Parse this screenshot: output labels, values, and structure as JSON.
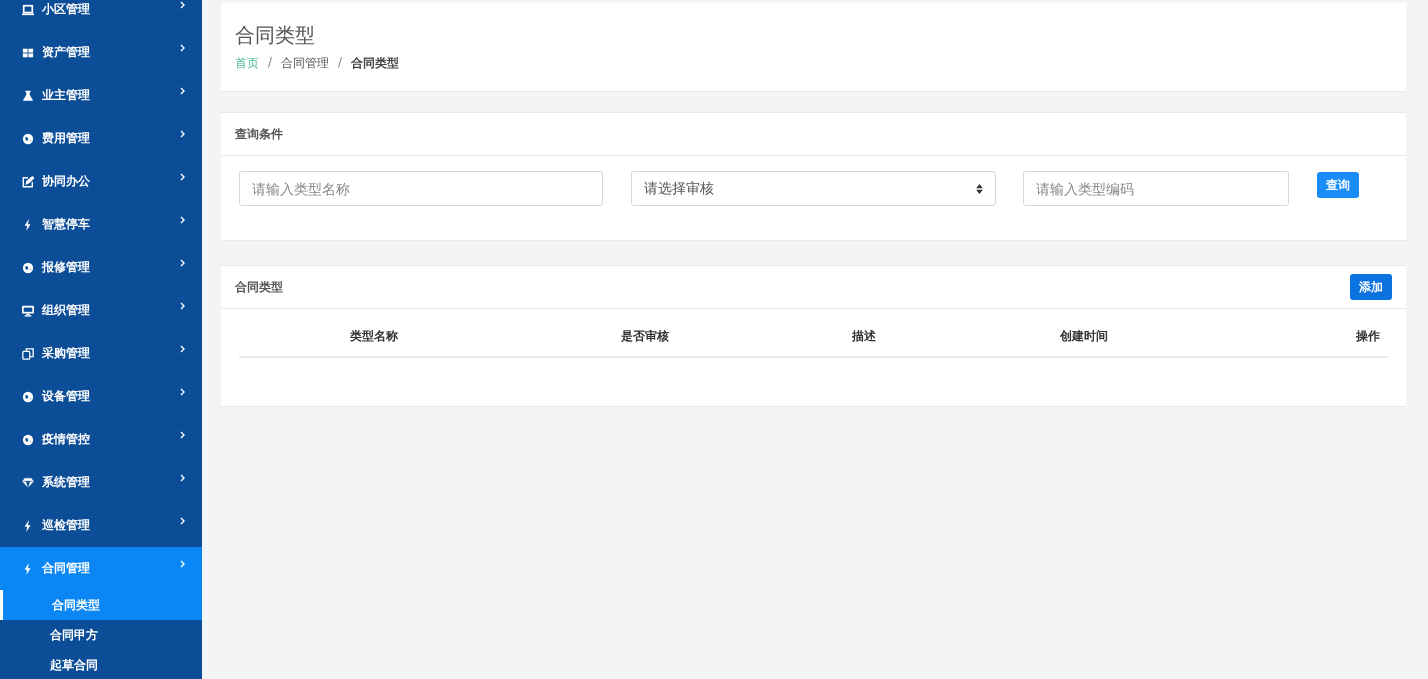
{
  "sidebar": {
    "items": [
      {
        "label": "小区管理",
        "selected": false
      },
      {
        "label": "资产管理",
        "selected": false
      },
      {
        "label": "业主管理",
        "selected": false
      },
      {
        "label": "费用管理",
        "selected": false
      },
      {
        "label": "协同办公",
        "selected": false
      },
      {
        "label": "智慧停车",
        "selected": false
      },
      {
        "label": "报修管理",
        "selected": false
      },
      {
        "label": "组织管理",
        "selected": false
      },
      {
        "label": "采购管理",
        "selected": false
      },
      {
        "label": "设备管理",
        "selected": false
      },
      {
        "label": "疫情管控",
        "selected": false
      },
      {
        "label": "系统管理",
        "selected": false
      },
      {
        "label": "巡检管理",
        "selected": false
      },
      {
        "label": "合同管理",
        "selected": true,
        "expanded": true,
        "children": [
          {
            "label": "合同类型",
            "selected": true
          },
          {
            "label": "合同甲方",
            "selected": false
          },
          {
            "label": "起草合同",
            "selected": false
          }
        ]
      }
    ]
  },
  "page_header": {
    "title": "合同类型",
    "separator": "/",
    "breadcrumb": [
      {
        "label": "首页",
        "kind": "link"
      },
      {
        "label": "合同管理",
        "kind": "text"
      },
      {
        "label": "合同类型",
        "kind": "current"
      }
    ]
  },
  "query": {
    "title": "查询条件",
    "fields": [
      {
        "kind": "input",
        "placeholder": "请输入类型名称"
      },
      {
        "kind": "select",
        "placeholder": "请选择审核"
      },
      {
        "kind": "input",
        "placeholder": "请输入类型编码"
      }
    ],
    "button": "查询"
  },
  "table": {
    "title": "合同类型",
    "add_button": "添加",
    "columns": [
      "类型名称",
      "是否审核",
      "描述",
      "创建时间",
      "操作"
    ]
  }
}
